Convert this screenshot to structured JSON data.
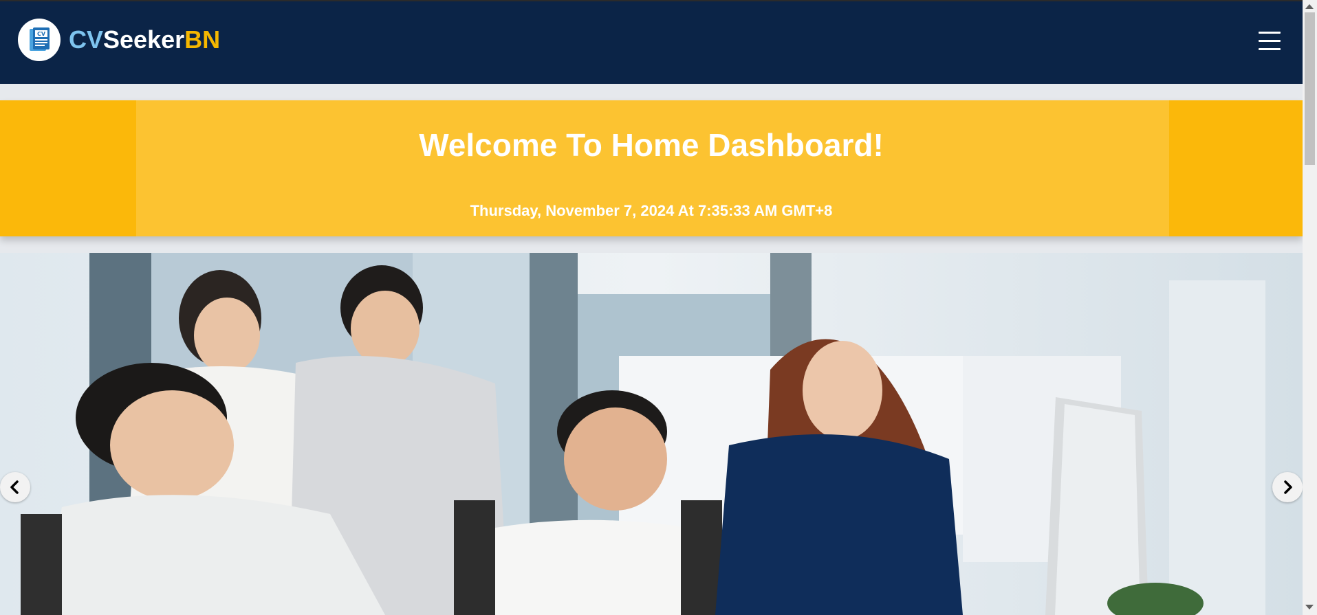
{
  "brand": {
    "part1": "CV",
    "part2": "Seeker",
    "part3": "BN",
    "badge_text": "CV"
  },
  "welcome": {
    "title": "Welcome To Home Dashboard!",
    "datetime": "Thursday, November 7, 2024 At 7:35:33 AM GMT+8"
  },
  "icons": {
    "menu": "hamburger-menu-icon",
    "prev": "chevron-left-icon",
    "next": "chevron-right-icon",
    "logo": "cv-document-icon"
  },
  "colors": {
    "navbar": "#0b2447",
    "banner": "#fcc331",
    "banner_edge": "#fbb80a",
    "brand_cv": "#7ec4ef",
    "brand_bn": "#f5b700"
  }
}
